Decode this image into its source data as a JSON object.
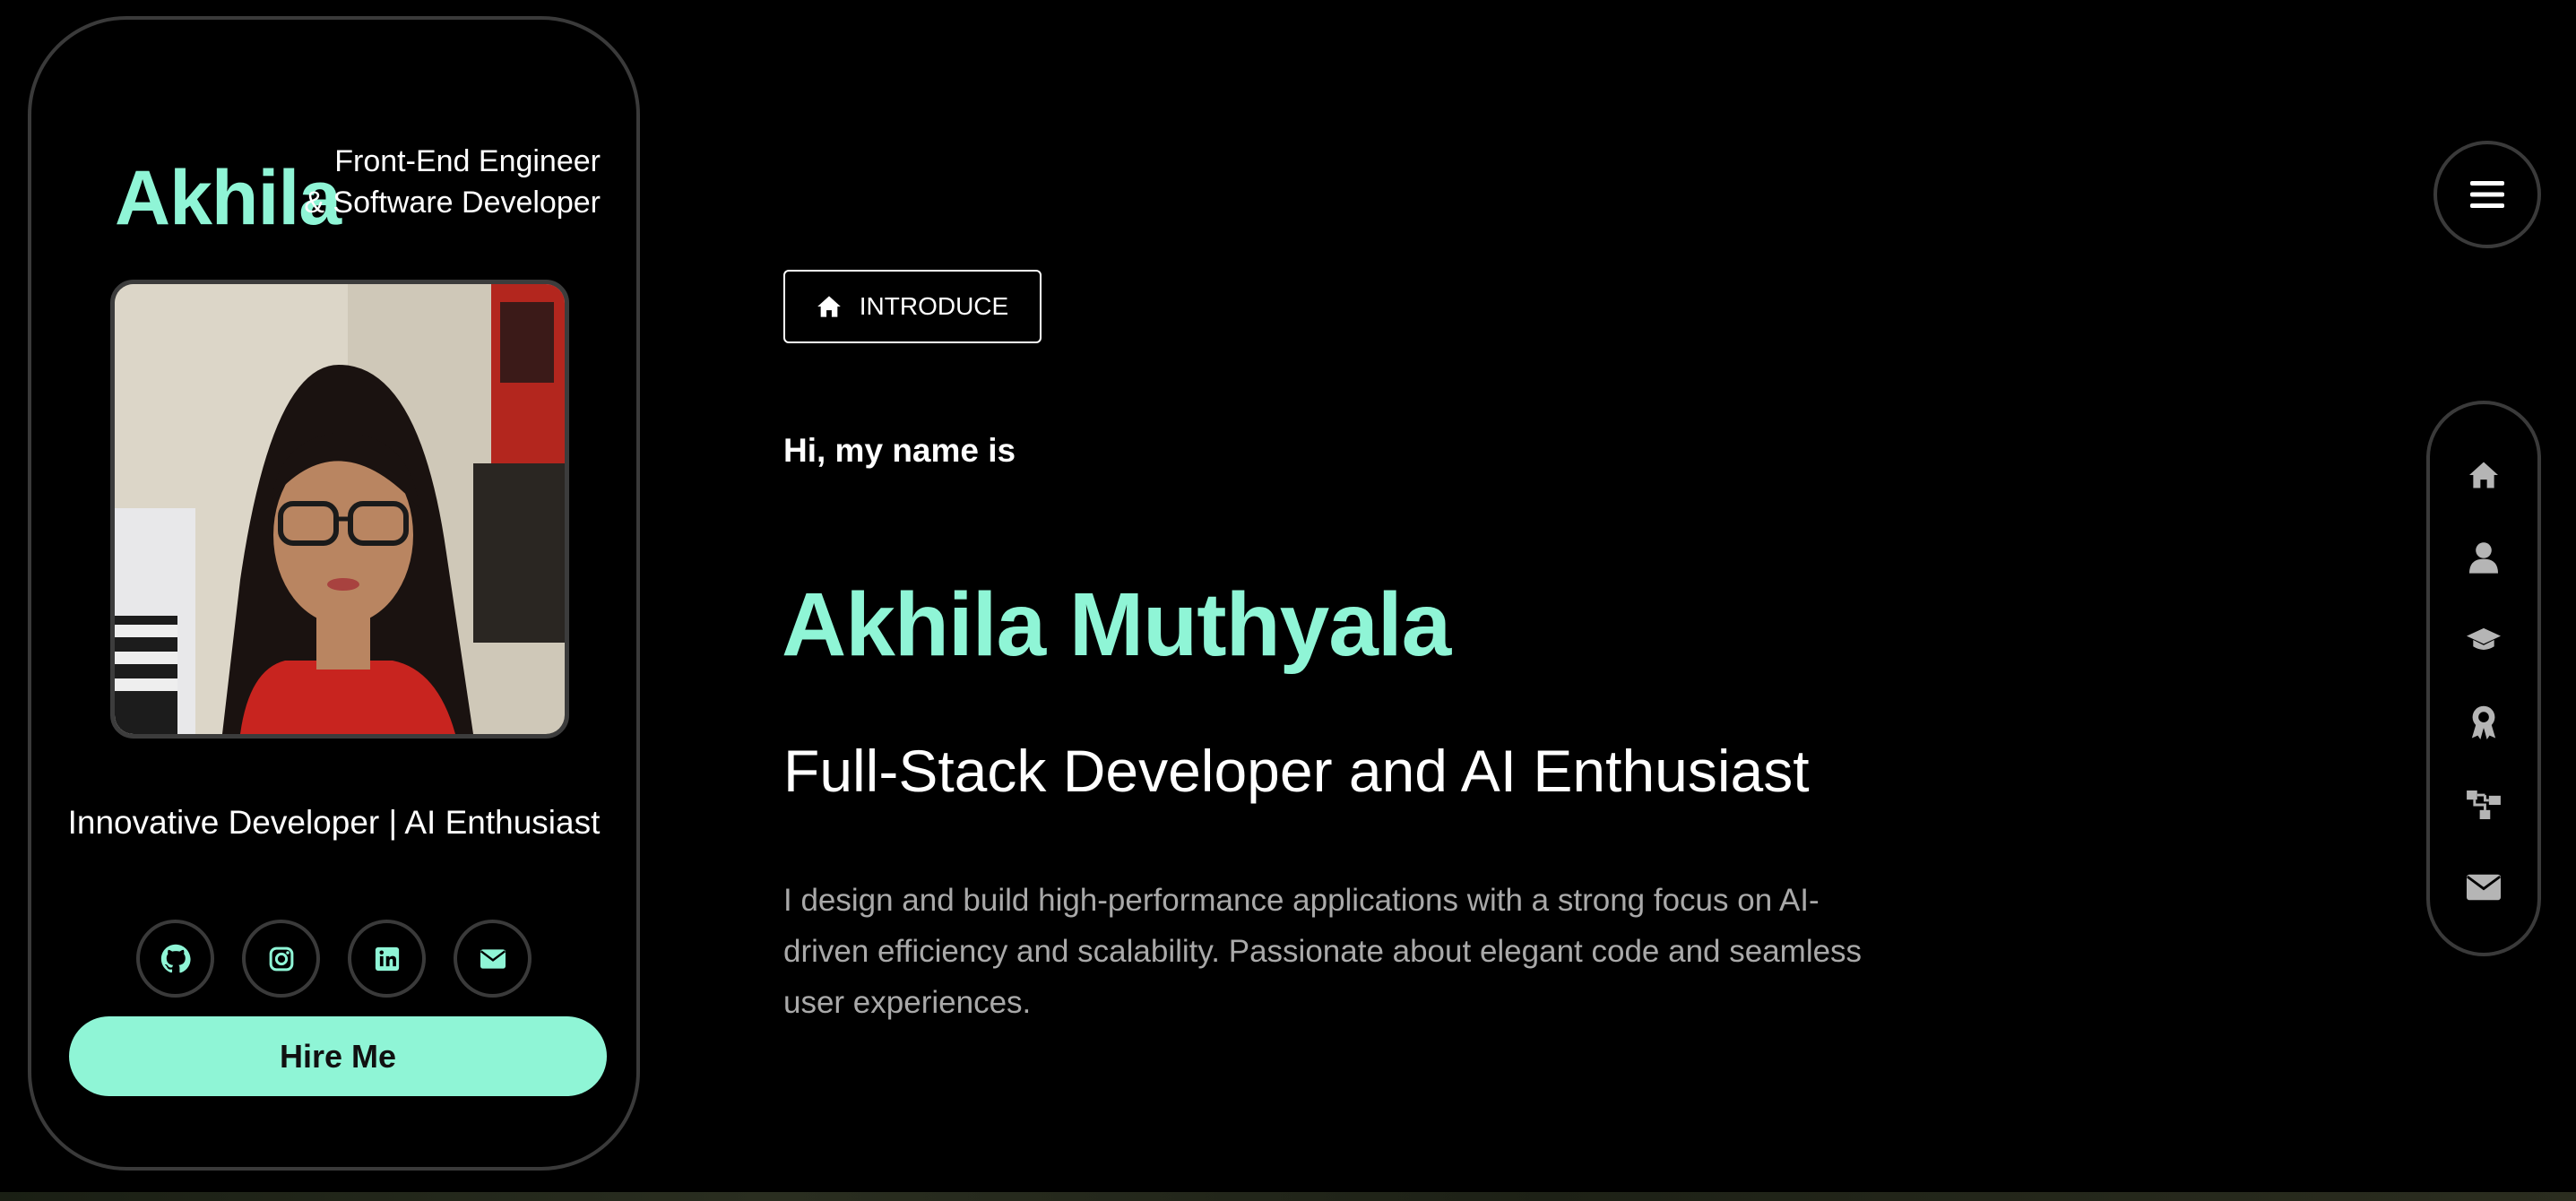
{
  "sidebar": {
    "brand": "Akhila",
    "tagline_line1": "Front-End Engineer",
    "tagline_line2": "& Software Developer",
    "subtitle": "Innovative Developer | AI Enthusiast",
    "socials": [
      {
        "icon": "github-icon"
      },
      {
        "icon": "instagram-icon"
      },
      {
        "icon": "linkedin-icon"
      },
      {
        "icon": "mail-icon"
      }
    ],
    "hire_label": "Hire Me"
  },
  "main": {
    "section_label": "INTRODUCE",
    "greeting": "Hi, my name is",
    "name": "Akhila Muthyala",
    "role": "Full-Stack Developer and AI Enthusiast",
    "description": "I design and build high-performance applications with a strong focus on AI-driven efficiency and scalability. Passionate about elegant code and seamless user experiences."
  },
  "nav": {
    "items": [
      "home-icon",
      "user-icon",
      "graduation-cap-icon",
      "award-icon",
      "sitemap-icon",
      "envelope-icon"
    ]
  },
  "colors": {
    "accent": "#8ff5d6",
    "background": "#000000",
    "border": "#3a3a3a",
    "muted_text": "#a9a9a9"
  }
}
